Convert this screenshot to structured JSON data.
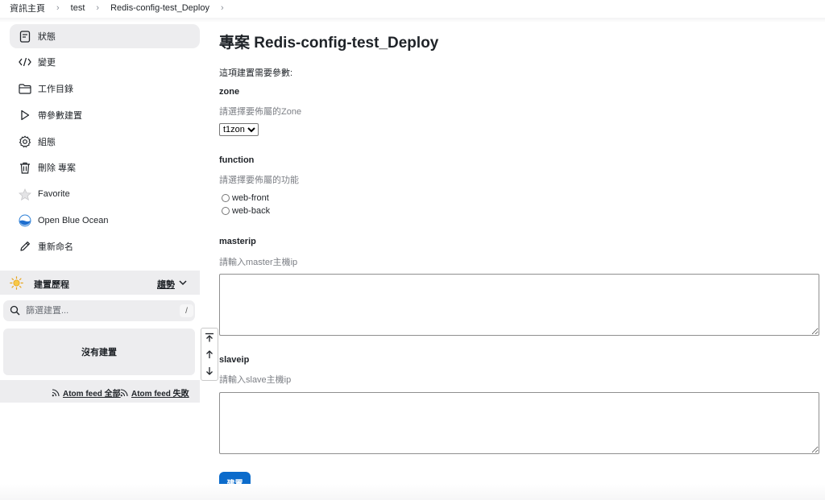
{
  "breadcrumb": [
    {
      "label": "資訊主頁"
    },
    {
      "label": "test"
    },
    {
      "label": "Redis-config-test_Deploy"
    }
  ],
  "sidebar": {
    "tasks": [
      {
        "label": "狀態",
        "icon": "status-icon"
      },
      {
        "label": "變更",
        "icon": "code-icon"
      },
      {
        "label": "工作目錄",
        "icon": "folder-icon"
      },
      {
        "label": "帶參數建置",
        "icon": "play-icon"
      },
      {
        "label": "組態",
        "icon": "gear-icon"
      },
      {
        "label": "刪除 專案",
        "icon": "trash-icon"
      },
      {
        "label": "Favorite",
        "icon": "star-icon"
      },
      {
        "label": "Open Blue Ocean",
        "icon": "blue-ocean-icon"
      },
      {
        "label": "重新命名",
        "icon": "pencil-icon"
      }
    ],
    "history": {
      "title": "建置歷程",
      "trend": "趨勢",
      "filter_placeholder": "篩選建置...",
      "shortcut": "/",
      "empty": "沒有建置"
    },
    "feeds": {
      "all": "Atom feed 全部",
      "failed": "Atom feed 失敗"
    }
  },
  "main": {
    "title": "專案 Redis-config-test_Deploy",
    "description": "這項建置需要參數:",
    "zone": {
      "name": "zone",
      "help": "請選擇要佈屬的Zone",
      "selected": "t1zone"
    },
    "function": {
      "name": "function",
      "help": "請選擇要佈屬的功能",
      "options": [
        "web-front",
        "web-back"
      ]
    },
    "masterip": {
      "name": "masterip",
      "help": "請輸入master主機ip",
      "value": ""
    },
    "slaveip": {
      "name": "slaveip",
      "help": "請輸入slave主機ip",
      "value": ""
    },
    "build_label": "建置"
  },
  "colors": {
    "accent": "#0b6bcb",
    "sidebar_bg": "#ededef",
    "text": "#1f2328",
    "muted": "#7c7f85"
  }
}
